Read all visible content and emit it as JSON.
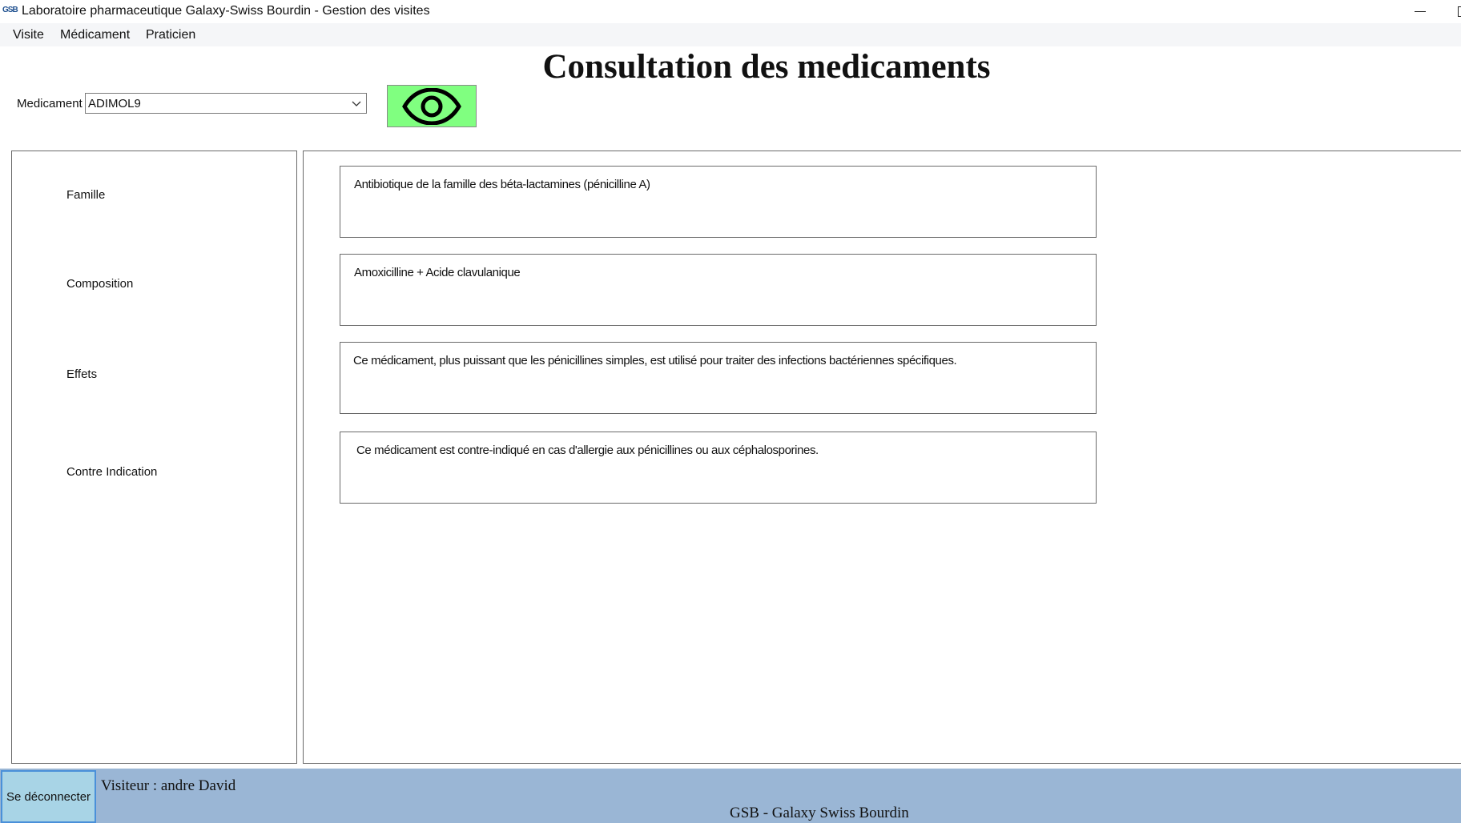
{
  "window": {
    "icon_text": "GSB",
    "title": "Laboratoire pharmaceutique Galaxy-Swiss Bourdin - Gestion des visites"
  },
  "menu": {
    "items": [
      {
        "label": "Visite"
      },
      {
        "label": "Médicament"
      },
      {
        "label": "Praticien"
      }
    ]
  },
  "page": {
    "heading": "Consultation des medicaments"
  },
  "selector": {
    "label": "Medicament",
    "value": "ADIMOL9",
    "view_button_icon": "eye-icon",
    "view_button_color": "#80ff80"
  },
  "fields": {
    "famille": {
      "label": "Famille",
      "value": "Antibiotique de la famille des béta-lactamines (pénicilline A)"
    },
    "composition": {
      "label": "Composition",
      "value": "Amoxicilline + Acide clavulanique"
    },
    "effets": {
      "label": "Effets",
      "value": "Ce médicament, plus puissant que les pénicillines simples, est utilisé pour traiter des infections bactériennes spécifiques."
    },
    "contre_indication": {
      "label": "Contre Indication",
      "value": "Ce médicament est contre-indiqué en cas d'allergie aux pénicillines ou aux céphalosporines."
    }
  },
  "footer": {
    "logout_label": "Se déconnecter",
    "visitor": "Visiteur : andre David",
    "brand": "GSB - Galaxy Swiss Bourdin",
    "background": "#9ab6d5",
    "logout_background": "#a8d4e6"
  }
}
